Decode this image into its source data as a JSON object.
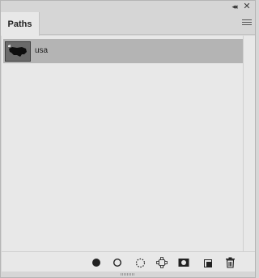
{
  "panel": {
    "tab_label": "Paths",
    "collapse_glyph": "◂◂",
    "close_glyph": "✕"
  },
  "paths": [
    {
      "name": "usa",
      "selected": true,
      "thumbnail_icon": "usa-map-thumbnail-icon"
    }
  ],
  "footer_tools": [
    {
      "name": "fill-path-icon"
    },
    {
      "name": "stroke-path-icon"
    },
    {
      "name": "load-as-selection-icon"
    },
    {
      "name": "make-work-path-icon"
    },
    {
      "name": "add-mask-icon"
    },
    {
      "name": "create-new-path-icon"
    },
    {
      "name": "delete-path-icon"
    }
  ],
  "colors": {
    "panel_bg": "#e8e8e8",
    "selected_row": "#b4b4b4",
    "chrome": "#d6d6d6"
  }
}
